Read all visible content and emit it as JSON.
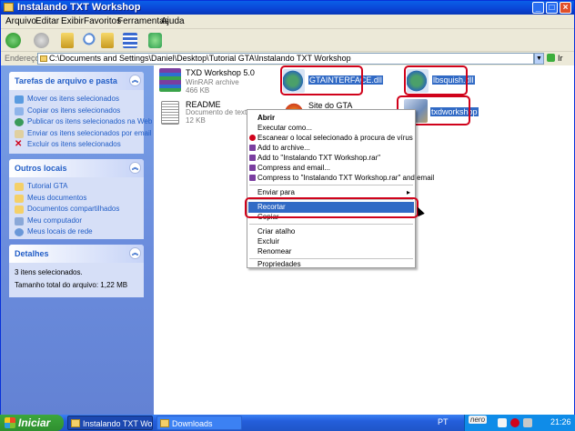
{
  "window": {
    "title": "Instalando TXT Workshop",
    "controls": {
      "minimize": "_",
      "maximize": "□",
      "close": "×"
    }
  },
  "menu": [
    "Arquivo",
    "Editar",
    "Exibir",
    "Favoritos",
    "Ferramentas",
    "Ajuda"
  ],
  "toolbar": {
    "icons": [
      "back-icon",
      "forward-icon",
      "up-folder-icon",
      "search-icon",
      "folders-icon",
      "views-icon",
      "sync-icon"
    ]
  },
  "address": {
    "label": "Endereço",
    "value": "C:\\Documents and Settings\\Daniel\\Desktop\\Tutorial GTA\\Instalando TXT Workshop",
    "go_label": "Ir"
  },
  "sidebar": {
    "tasks": {
      "title": "Tarefas de arquivo e pasta",
      "items": [
        "Mover os itens selecionados",
        "Copiar os itens selecionados",
        "Publicar os itens selecionados na Web",
        "Enviar os itens selecionados por email",
        "Excluir os itens selecionados"
      ]
    },
    "places": {
      "title": "Outros locais",
      "items": [
        "Tutorial GTA",
        "Meus documentos",
        "Documentos compartilhados",
        "Meu computador",
        "Meus locais de rede"
      ]
    },
    "details": {
      "title": "Detalhes",
      "count_text": "3 itens selecionados.",
      "size_text": "Tamanho total do arquivo: 1,22 MB"
    }
  },
  "files": {
    "txd_workshop": {
      "name": "TXD Workshop 5.0",
      "type": "WinRAR archive",
      "size": "466 KB"
    },
    "readme": {
      "name": "README",
      "type": "Documento de texto",
      "size": "12 KB"
    },
    "gtainterface": {
      "name": "GTAINTERFACE.dll"
    },
    "site": {
      "name": "Site do GTA"
    },
    "lbsquish": {
      "name": "lbsquish.dll"
    },
    "txdworkshop": {
      "name": "txdworkshop"
    }
  },
  "context_menu": {
    "items": [
      "Abrir",
      "Executar como...",
      "Escanear o local selecionado à procura de vírus",
      "Add to archive...",
      "Add to \"Instalando TXT Workshop.rar\"",
      "Compress and email...",
      "Compress to \"Instalando TXT Workshop.rar\" and email",
      "Enviar para",
      "Recortar",
      "Copiar",
      "Criar atalho",
      "Excluir",
      "Renomear",
      "Propriedades"
    ],
    "submenu_arrow": "▸"
  },
  "taskbar": {
    "start_label": "Iniciar",
    "tasks": [
      "Instalando TXT Work...",
      "Downloads"
    ],
    "tray": {
      "language": "PT",
      "brand": "nero",
      "clock": "21:26"
    }
  },
  "colors": {
    "highlight": "#316ac5",
    "annotation_red": "#d0021b",
    "sidebar_blue": "#6b8ddd"
  }
}
